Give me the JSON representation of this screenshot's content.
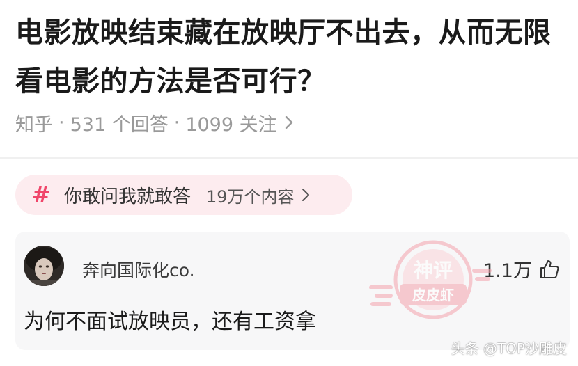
{
  "question": {
    "title": "电影放映结束藏在放映厅不出去，从而无限看电影的方法是否可行？"
  },
  "meta": {
    "source": "知乎",
    "answers": "531 个回答",
    "followers": "1099 关注",
    "separator": "·"
  },
  "topic": {
    "hash_symbol": "#",
    "name": "你敢问我就敢答",
    "count": "19万个内容"
  },
  "comment": {
    "username": "奔向国际化co.",
    "likes": "1.1万",
    "text": "为何不面试放映员，还有工资拿"
  },
  "stamp": {
    "line1": "神评",
    "line2": "皮皮虾"
  },
  "watermark": {
    "text": "头条 @TOP沙雕皮"
  },
  "colors": {
    "accent_pink": "#f0466a",
    "chip_bg": "#fdecef",
    "meta_gray": "#9a9a9a",
    "card_bg": "#f7f7f8"
  },
  "icons": {
    "meta_chevron": "chevron-right-icon",
    "topic_hash": "hash-icon",
    "like": "thumbs-up-icon"
  }
}
